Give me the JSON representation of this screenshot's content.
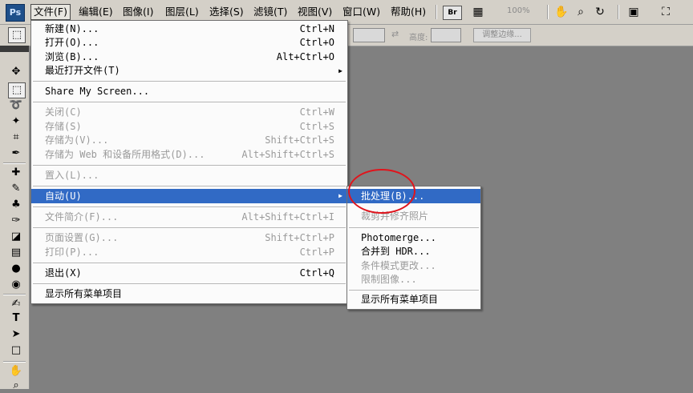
{
  "app": {
    "logo_text": "Ps"
  },
  "menubar": {
    "items": [
      "文件(F)",
      "编辑(E)",
      "图像(I)",
      "图层(L)",
      "选择(S)",
      "滤镜(T)",
      "视图(V)",
      "窗口(W)",
      "帮助(H)"
    ],
    "br_label": "Br",
    "zoom": "100%"
  },
  "optionsbar": {
    "height_label": "高度:",
    "refine_edge_label": "调整边缘..."
  },
  "file_menu": {
    "new": {
      "label": "新建(N)...",
      "shortcut": "Ctrl+N"
    },
    "open": {
      "label": "打开(O)...",
      "shortcut": "Ctrl+O"
    },
    "browse": {
      "label": "浏览(B)...",
      "shortcut": "Alt+Ctrl+O"
    },
    "recent": {
      "label": "最近打开文件(T)"
    },
    "share": {
      "label": "Share My Screen..."
    },
    "close": {
      "label": "关闭(C)",
      "shortcut": "Ctrl+W"
    },
    "save": {
      "label": "存储(S)",
      "shortcut": "Ctrl+S"
    },
    "save_as": {
      "label": "存储为(V)...",
      "shortcut": "Shift+Ctrl+S"
    },
    "save_web": {
      "label": "存储为 Web 和设备所用格式(D)...",
      "shortcut": "Alt+Shift+Ctrl+S"
    },
    "place": {
      "label": "置入(L)..."
    },
    "automate": {
      "label": "自动(U)"
    },
    "file_info": {
      "label": "文件简介(F)...",
      "shortcut": "Alt+Shift+Ctrl+I"
    },
    "page_setup": {
      "label": "页面设置(G)...",
      "shortcut": "Shift+Ctrl+P"
    },
    "print": {
      "label": "打印(P)...",
      "shortcut": "Ctrl+P"
    },
    "exit": {
      "label": "退出(X)",
      "shortcut": "Ctrl+Q"
    },
    "show_all": {
      "label": "显示所有菜单项目"
    }
  },
  "automate_menu": {
    "batch": "批处理(B)...",
    "crop_straighten": "裁剪并修齐照片",
    "photomerge": "Photomerge...",
    "merge_hdr": "合并到 HDR...",
    "conditional_mode": "条件模式更改...",
    "fit_image": "限制图像...",
    "show_all": "显示所有菜单项目"
  },
  "colors": {
    "highlight": "#316ac5",
    "annotation": "#e0141c",
    "workspace": "#808080"
  }
}
